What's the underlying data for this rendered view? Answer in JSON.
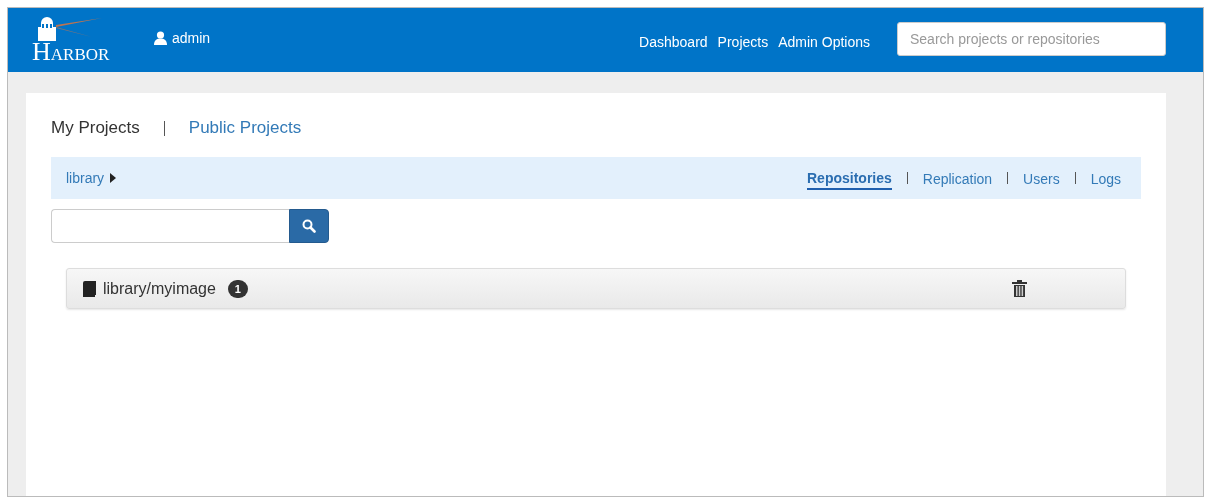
{
  "header": {
    "logo": "HARBOR",
    "user": "admin",
    "nav": [
      "Dashboard",
      "Projects",
      "Admin Options"
    ],
    "search": {
      "placeholder": "Search projects or repositories"
    }
  },
  "project_tabs": [
    {
      "label": "My Projects",
      "selected": true
    },
    {
      "label": "Public Projects",
      "selected": false
    }
  ],
  "breadcrumb": "library",
  "section_tabs": [
    {
      "label": "Repositories",
      "selected": true
    },
    {
      "label": "Replication",
      "selected": false
    },
    {
      "label": "Users",
      "selected": false
    },
    {
      "label": "Logs",
      "selected": false
    }
  ],
  "repositories": [
    {
      "name": "library/myimage",
      "count": "1"
    }
  ]
}
